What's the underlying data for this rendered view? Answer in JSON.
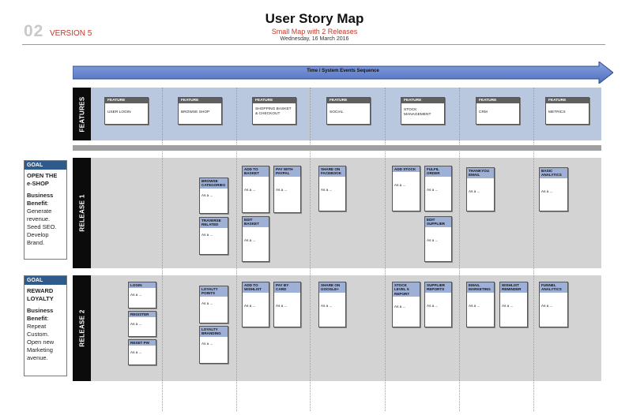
{
  "header": {
    "number": "02",
    "version": "VERSION 5",
    "title": "User Story Map",
    "subtitle": "Small Map with 2 Releases",
    "date": "Wednesday, 16 March 2016"
  },
  "timeline": {
    "label": "Time / System Events Sequence"
  },
  "lanes": {
    "features": "FEATURES",
    "release1": "RELEASE 1",
    "release2": "RELEASE 2"
  },
  "features": [
    {
      "head": "FEATURE",
      "title": "USER LOGIN"
    },
    {
      "head": "FEATURE",
      "title": "BROWSE SHOP"
    },
    {
      "head": "FEATURE",
      "title": "SHOPPING BASKET & CHECKOUT"
    },
    {
      "head": "FEATURE",
      "title": "SOCIAL"
    },
    {
      "head": "FEATURE",
      "title": "STOCK MANAGEMENT"
    },
    {
      "head": "FEATURE",
      "title": "CRM"
    },
    {
      "head": "FEATURE",
      "title": "METRICS"
    }
  ],
  "goals": [
    {
      "head": "GOAL",
      "title": "OPEN THE e-SHOP",
      "bb_label": "Business Benefit",
      "text": "Generate revenue. Seed SEO. Develop Brand."
    },
    {
      "head": "GOAL",
      "title": "REWARD LOYALTY",
      "bb_label": "Business Benefit",
      "text": "Repeat Custom. Open new Marketing avenue."
    }
  ],
  "stories": {
    "r1": [
      {
        "head": "BROWSE CATEGORIES",
        "body": "As a ..."
      },
      {
        "head": "TRAVERSE RELATED",
        "body": "As a ..."
      },
      {
        "head": "ADD TO BASKET",
        "body": "As a ..."
      },
      {
        "head": "PAY WITH PAYPAL",
        "body": "As a ..."
      },
      {
        "head": "EDIT BASKET",
        "body": "As a ..."
      },
      {
        "head": "SHARE ON FACEBOOK",
        "body": "As a ..."
      },
      {
        "head": "ADD STOCK",
        "body": "As a ..."
      },
      {
        "head": "FULFIL ORDER",
        "body": "As a ..."
      },
      {
        "head": "EDIT SUPPLIER",
        "body": "As a ..."
      },
      {
        "head": "THANKYOU EMAIL",
        "body": "As a ..."
      },
      {
        "head": "BASIC ANALYTICS",
        "body": "As a ..."
      }
    ],
    "r2": [
      {
        "head": "LOGIN",
        "body": "As a ..."
      },
      {
        "head": "REGISTER",
        "body": "As a ..."
      },
      {
        "head": "RESET PW",
        "body": "As a ..."
      },
      {
        "head": "LOYALTY POINTS",
        "body": "As a ..."
      },
      {
        "head": "LOYALTY BRANDING",
        "body": "As a ..."
      },
      {
        "head": "ADD TO WISHLIST",
        "body": "As a ..."
      },
      {
        "head": "PAY BY CARD",
        "body": "As a ..."
      },
      {
        "head": "SHARE ON GOOGLE+",
        "body": "As a ..."
      },
      {
        "head": "STOCK LEVEL 5 REPORT",
        "body": "As a ..."
      },
      {
        "head": "SUPPLIER REPORTS",
        "body": "As a ..."
      },
      {
        "head": "EMAIL MARKETING",
        "body": "As a ..."
      },
      {
        "head": "WISHLIST REMINDER",
        "body": "As a ..."
      },
      {
        "head": "FUNNEL ANALYTICS",
        "body": "As a ..."
      }
    ]
  }
}
